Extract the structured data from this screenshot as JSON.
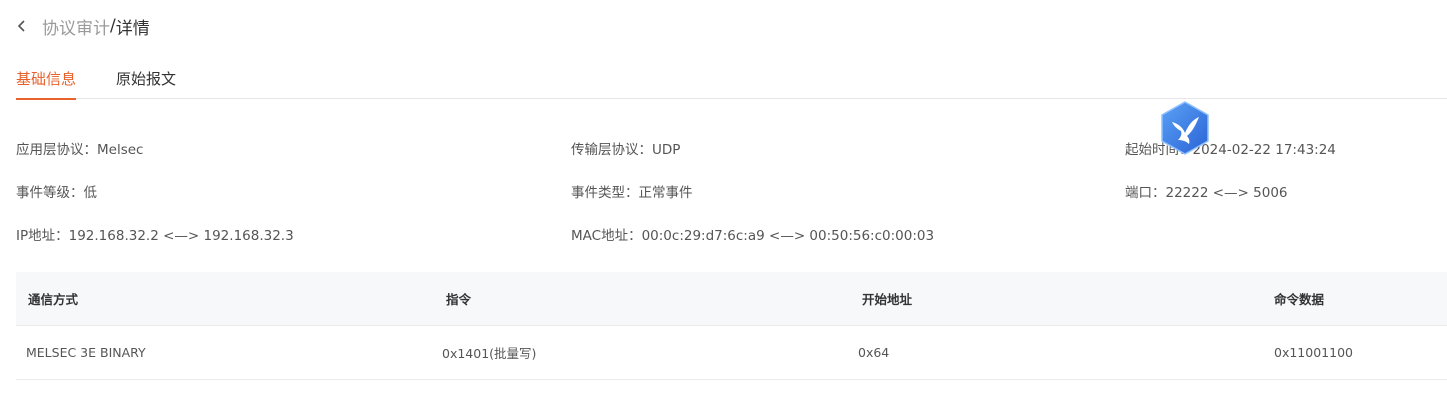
{
  "header": {
    "parent": "协议审计",
    "separator": "/",
    "current": "详情"
  },
  "tabs": [
    {
      "label": "基础信息",
      "active": true
    },
    {
      "label": "原始报文",
      "active": false
    }
  ],
  "info": {
    "app_protocol": {
      "label": "应用层协议：",
      "value": "Melsec"
    },
    "transport_protocol": {
      "label": "传输层协议：",
      "value": "UDP"
    },
    "start_time": {
      "label": "起始时间：",
      "value": "2024-02-22 17:43:24"
    },
    "event_level": {
      "label": "事件等级：",
      "value": "低"
    },
    "event_type": {
      "label": "事件类型：",
      "value": "正常事件"
    },
    "port": {
      "label": "端口：",
      "value": "22222 <—> 5006"
    },
    "ip": {
      "label": "IP地址：",
      "value": "192.168.32.2 <—> 192.168.32.3"
    },
    "mac": {
      "label": "MAC地址：",
      "value": "00:0c:29:d7:6c:a9 <—> 00:50:56:c0:00:03"
    }
  },
  "table": {
    "headers": [
      "通信方式",
      "指令",
      "开始地址",
      "命令数据"
    ],
    "rows": [
      [
        "MELSEC 3E BINARY",
        "0x1401(批量写)",
        "0x64",
        "0x11001100"
      ]
    ]
  },
  "colors": {
    "accent": "#e8612c",
    "badge": "#3a7be0"
  },
  "icons": {
    "back": "chevron-left-icon",
    "badge": "bird-badge-icon"
  }
}
